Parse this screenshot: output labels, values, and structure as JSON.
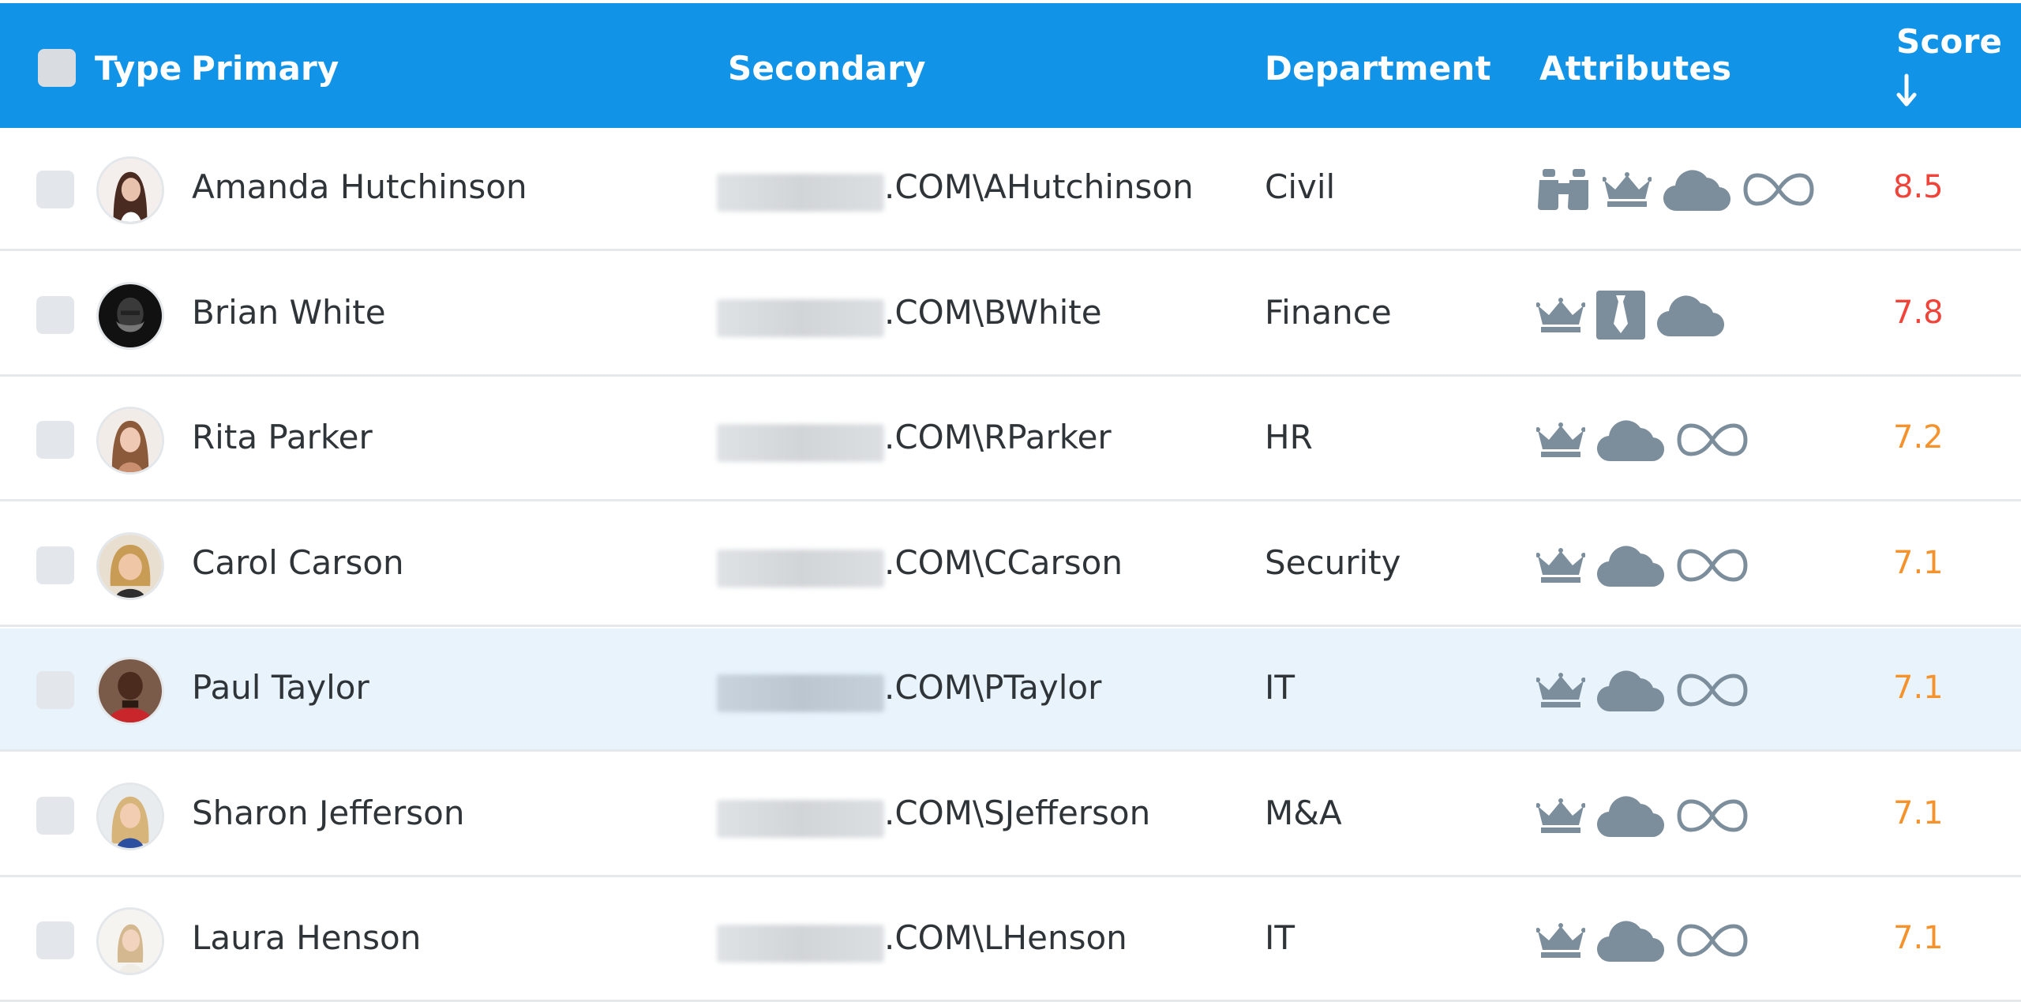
{
  "header": {
    "type": "Type",
    "primary": "Primary",
    "secondary": "Secondary",
    "department": "Department",
    "attributes": "Attributes",
    "score": "Score"
  },
  "colors": {
    "header_bg": "#1193e8",
    "icon": "#7c8e9c",
    "score_high": "#f0443a",
    "score_medium": "#f5922b",
    "selected_row": "#e8f3fc"
  },
  "rows": [
    {
      "primary": "Amanda Hutchinson",
      "secondary": ".COM\\AHutchinson",
      "department": "Civil",
      "attributes": [
        "binoculars-icon",
        "crown-icon",
        "cloud-icon",
        "infinity-icon"
      ],
      "score": "8.5",
      "score_color": "#f0443a",
      "selected": false
    },
    {
      "primary": "Brian White",
      "secondary": ".COM\\BWhite",
      "department": "Finance",
      "attributes": [
        "crown-icon",
        "necktie-icon",
        "cloud-icon"
      ],
      "score": "7.8",
      "score_color": "#f0443a",
      "selected": false
    },
    {
      "primary": "Rita Parker",
      "secondary": ".COM\\RParker",
      "department": "HR",
      "attributes": [
        "crown-icon",
        "cloud-icon",
        "infinity-icon"
      ],
      "score": "7.2",
      "score_color": "#f5922b",
      "selected": false
    },
    {
      "primary": "Carol Carson",
      "secondary": ".COM\\CCarson",
      "department": "Security",
      "attributes": [
        "crown-icon",
        "cloud-icon",
        "infinity-icon"
      ],
      "score": "7.1",
      "score_color": "#f5922b",
      "selected": false
    },
    {
      "primary": "Paul Taylor",
      "secondary": ".COM\\PTaylor",
      "department": "IT",
      "attributes": [
        "crown-icon",
        "cloud-icon",
        "infinity-icon"
      ],
      "score": "7.1",
      "score_color": "#f5922b",
      "selected": true
    },
    {
      "primary": "Sharon Jefferson",
      "secondary": ".COM\\SJefferson",
      "department": "M&A",
      "attributes": [
        "crown-icon",
        "cloud-icon",
        "infinity-icon"
      ],
      "score": "7.1",
      "score_color": "#f5922b",
      "selected": false
    },
    {
      "primary": "Laura Henson",
      "secondary": ".COM\\LHenson",
      "department": "IT",
      "attributes": [
        "crown-icon",
        "cloud-icon",
        "infinity-icon"
      ],
      "score": "7.1",
      "score_color": "#f5922b",
      "selected": false
    }
  ]
}
